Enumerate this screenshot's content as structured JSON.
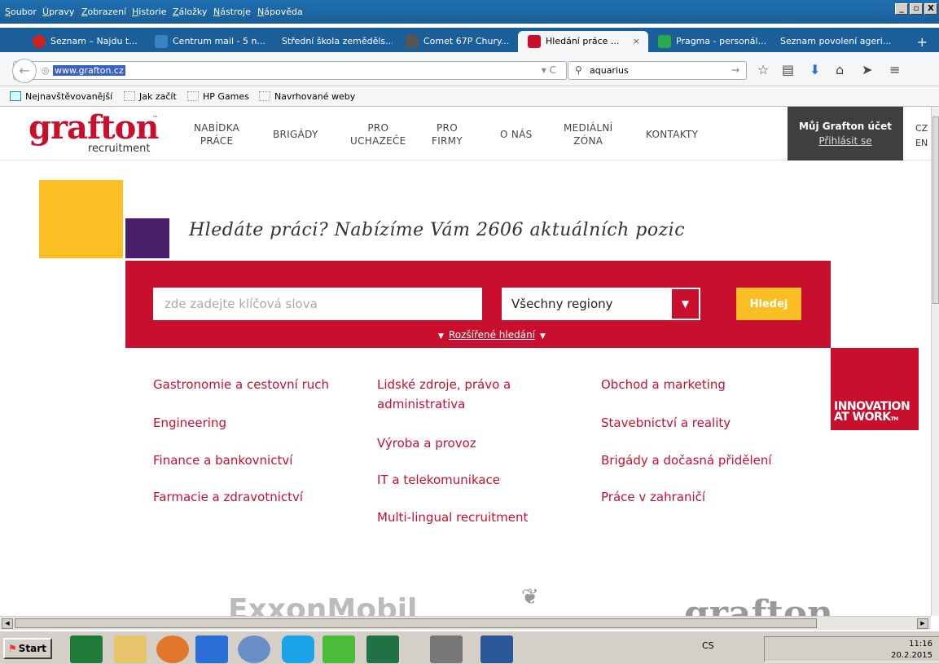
{
  "browser": {
    "menu": [
      "Soubor",
      "Úpravy",
      "Zobrazení",
      "Historie",
      "Záložky",
      "Nástroje",
      "Nápověda"
    ],
    "window_buttons": [
      "_",
      "▫",
      "X"
    ],
    "tabs": [
      {
        "label": "Seznam – Najdu t...",
        "color": "#cc2222"
      },
      {
        "label": "Centrum mail - 5 n...",
        "color": "#3b82c4"
      },
      {
        "label": "Střední škola zeměděls...",
        "color": "#777777"
      },
      {
        "label": "Comet 67P Chury...",
        "color": "#555555"
      },
      {
        "label": "Hledání práce ...",
        "color": "#c8102e",
        "active": true
      },
      {
        "label": "Pragma - personál...",
        "color": "#2aa84a"
      },
      {
        "label": "Seznam povolení ageri...",
        "color": "#1a5e9a"
      }
    ],
    "new_tab": "+",
    "tab_close": "×",
    "url": "www.grafton.cz",
    "search_value": "aquarius",
    "bookmarks": [
      "Nejnavštěvovanější",
      "Jak začít",
      "HP Games",
      "Navrhované weby"
    ]
  },
  "site": {
    "logo": {
      "name": "grafton",
      "sub": "recruitment",
      "tm": "™"
    },
    "nav": [
      {
        "line1": "NABÍDKA",
        "line2": "PRÁCE"
      },
      {
        "line1": "BRIGÁDY",
        "line2": ""
      },
      {
        "line1": "PRO",
        "line2": "UCHAZEČE"
      },
      {
        "line1": "PRO",
        "line2": "FIRMY"
      },
      {
        "line1": "O NÁS",
        "line2": ""
      },
      {
        "line1": "MEDIÁLNÍ",
        "line2": "ZÓNA"
      },
      {
        "line1": "KONTAKTY",
        "line2": ""
      }
    ],
    "account": {
      "title": "Můj Grafton účet",
      "login": "Přihlásit se"
    },
    "lang": [
      "CZ",
      "EN"
    ],
    "headline": "Hledáte práci? Nabízíme Vám 2606 aktuálních pozic",
    "search": {
      "placeholder": "zde zadejte klíčová slova",
      "region": "Všechny regiony",
      "button": "Hledej",
      "advanced": "Rozšířené hledání"
    },
    "categories": {
      "col1": [
        "Gastronomie a cestovní ruch",
        "Engineering",
        "Finance a bankovnictví",
        "Farmacie a zdravotnictví"
      ],
      "col2": [
        "Lidské zdroje, právo a",
        "administrativa",
        "Výroba a provoz",
        "IT a telekomunikace",
        "Multi-lingual recruitment"
      ],
      "col3": [
        "Obchod a marketing",
        "Stavebnictví a reality",
        "Brigády a dočasná přidělení",
        "Práce v zahraničí"
      ]
    },
    "innovation": {
      "line1": "INNOVATION",
      "line2": "AT WORK",
      "tm": "TM"
    },
    "partners": [
      "ExxonMobil",
      "grafton"
    ],
    "colors": {
      "brand_red": "#c8102e",
      "yellow": "#fbbf24",
      "purple": "#4b1e6b"
    }
  },
  "taskbar": {
    "start": "Start",
    "lang": "CS",
    "time": "11:16",
    "date": "20.2.2015",
    "apps": [
      "chart-app-icon",
      "folder-icon",
      "firefox-icon",
      "outlook-icon",
      "network-icon",
      "skype-icon",
      "icq-icon",
      "excel-icon",
      "pdf-icon",
      "word-icon"
    ]
  }
}
